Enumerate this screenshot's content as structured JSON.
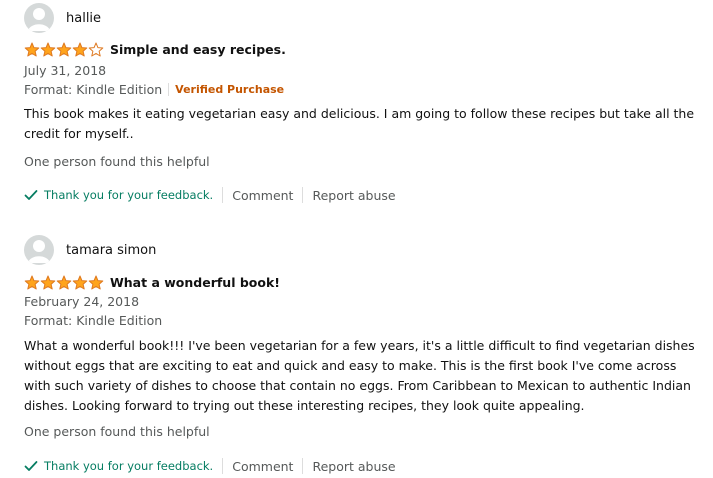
{
  "colors": {
    "star": "#ffa41c",
    "verified": "#c45500",
    "thanks": "#067d62",
    "muted": "#565959"
  },
  "reviews": [
    {
      "user": "hallie",
      "rating": 4,
      "title": "Simple and easy recipes.",
      "date": "July 31, 2018",
      "format": "Format: Kindle Edition",
      "verified": "Verified Purchase",
      "body": "This book makes it eating vegetarian easy and delicious. I am going to follow these recipes but take all the credit for myself..",
      "helpful": "One person found this helpful",
      "thanks": "Thank you for your feedback.",
      "comment": "Comment",
      "report": "Report abuse"
    },
    {
      "user": "tamara simon",
      "rating": 5,
      "title": "What a wonderful book!",
      "date": "February 24, 2018",
      "format": "Format: Kindle Edition",
      "body": "What a wonderful book!!! I've been vegetarian for a few years, it's a little difficult to find vegetarian dishes without eggs that are exciting to eat and quick and easy to make. This is the first book I've come across with such variety of dishes to choose that contain no eggs. From Caribbean to Mexican to authentic Indian dishes. Looking forward to trying out these interesting recipes, they look quite appealing.",
      "helpful": "One person found this helpful",
      "thanks": "Thank you for your feedback.",
      "comment": "Comment",
      "report": "Report abuse"
    }
  ]
}
